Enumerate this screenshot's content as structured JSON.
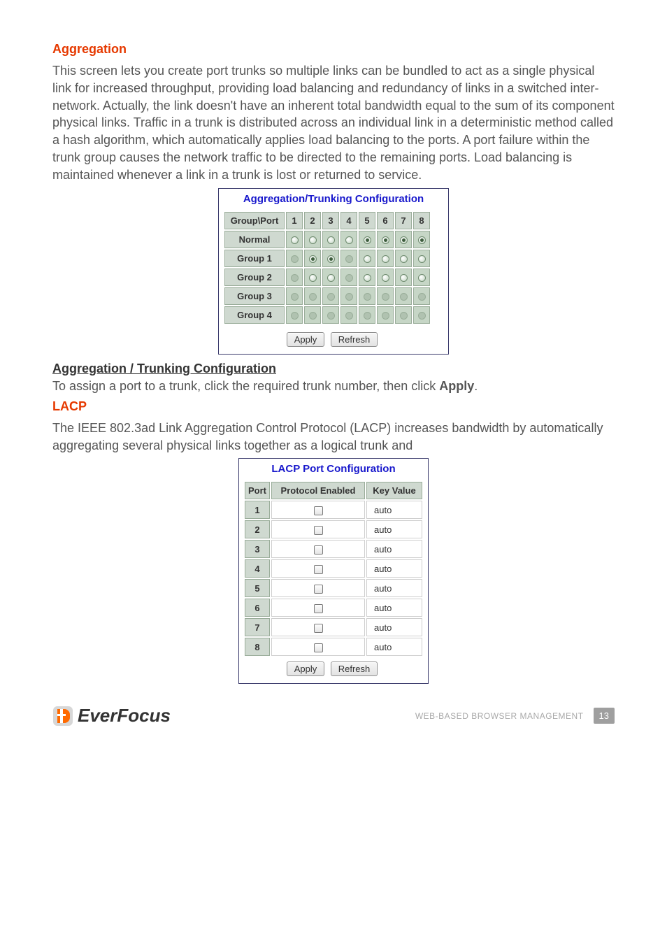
{
  "sections": {
    "aggregation": {
      "heading": "Aggregation",
      "paragraph": "This screen lets you create port trunks so multiple links can be bundled to act as a single physical link for increased throughput, providing load balancing and redundancy of links in a switched inter-network. Actually, the link doesn't have an inherent total bandwidth equal to the sum of its component physical links. Traffic in a trunk is distributed across an individual link in a deterministic method called a hash algorithm, which automatically applies load balancing to the ports. A port failure within the trunk group causes the network traffic to be directed to the remaining ports. Load balancing is maintained whenever a link in a trunk is lost or returned to service."
    },
    "aggregation_sub": {
      "subheading": "Aggregation / Trunking Configuration",
      "instruction_prefix": "To assign a port to a trunk, click the required trunk number, then click ",
      "instruction_bold": "Apply",
      "instruction_suffix": "."
    },
    "lacp": {
      "heading": "LACP",
      "paragraph": "The IEEE 802.3ad Link Aggregation Control Protocol (LACP) increases bandwidth by automatically aggregating several physical links together as a logical trunk and"
    }
  },
  "agg_config": {
    "title": "Aggregation/Trunking Configuration",
    "row_header": "Group\\Port",
    "ports": [
      "1",
      "2",
      "3",
      "4",
      "5",
      "6",
      "7",
      "8"
    ],
    "rows": [
      {
        "label": "Normal",
        "cells": [
          "on",
          "off",
          "off",
          "on",
          "checked",
          "checked",
          "checked",
          "checked"
        ]
      },
      {
        "label": "Group 1",
        "cells": [
          "disabled",
          "checked",
          "checked",
          "disabled",
          "off",
          "off",
          "off",
          "off"
        ]
      },
      {
        "label": "Group 2",
        "cells": [
          "disabled",
          "off",
          "off",
          "disabled",
          "off",
          "off",
          "off",
          "off"
        ]
      },
      {
        "label": "Group 3",
        "cells": [
          "disabled",
          "disabled",
          "disabled",
          "disabled",
          "disabled",
          "disabled",
          "disabled",
          "disabled"
        ]
      },
      {
        "label": "Group 4",
        "cells": [
          "disabled",
          "disabled",
          "disabled",
          "disabled",
          "disabled",
          "disabled",
          "disabled",
          "disabled"
        ]
      }
    ],
    "apply": "Apply",
    "refresh": "Refresh"
  },
  "lacp_config": {
    "title": "LACP Port Configuration",
    "headers": {
      "port": "Port",
      "protocol": "Protocol Enabled",
      "key": "Key Value"
    },
    "rows": [
      {
        "port": "1",
        "checked": false,
        "key": "auto"
      },
      {
        "port": "2",
        "checked": false,
        "key": "auto"
      },
      {
        "port": "3",
        "checked": false,
        "key": "auto"
      },
      {
        "port": "4",
        "checked": false,
        "key": "auto"
      },
      {
        "port": "5",
        "checked": false,
        "key": "auto"
      },
      {
        "port": "6",
        "checked": false,
        "key": "auto"
      },
      {
        "port": "7",
        "checked": false,
        "key": "auto"
      },
      {
        "port": "8",
        "checked": false,
        "key": "auto"
      }
    ],
    "apply": "Apply",
    "refresh": "Refresh"
  },
  "footer": {
    "brand_ever": "Ever",
    "brand_focus": "Focus",
    "label": "WEB-BASED BROWSER MANAGEMENT",
    "page": "13"
  }
}
